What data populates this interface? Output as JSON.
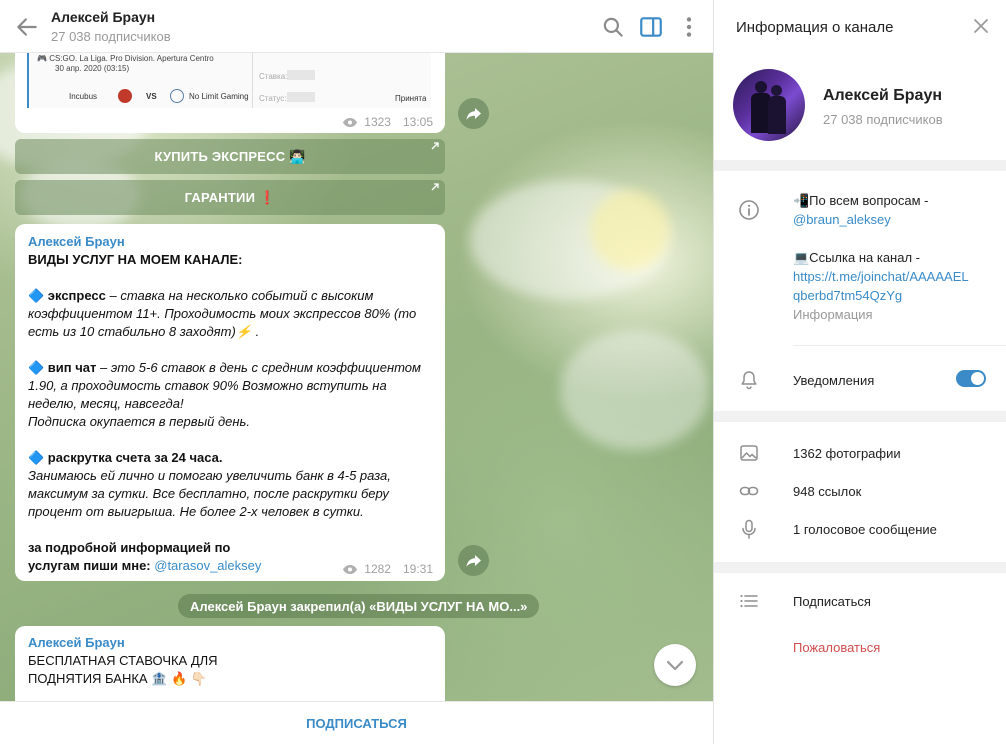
{
  "header": {
    "title": "Алексей Браун",
    "subtitle": "27 038 подписчиков"
  },
  "forwarded_card": {
    "match_line": "CS:GO. La Liga. Pro Division. Apertura Centro",
    "date": "30 апр. 2020 (03:15)",
    "team_left": "Incubus",
    "vs": "VS",
    "team_right": "No Limit Gaming",
    "stake_label": "Ставка:",
    "status_label": "Статус:",
    "status_value": "Принята"
  },
  "msg1_meta": {
    "views": "1323",
    "time": "13:05"
  },
  "keyboard": {
    "btn1": "КУПИТЬ ЭКСПРЕСС 👨🏻‍💻",
    "btn2": "ГАРАНТИИ ❗"
  },
  "msg2": {
    "author": "Алексей Браун",
    "heading": "ВИДЫ УСЛУГ НА МОЕМ КАНАЛЕ:",
    "p1_bold": "🔷 экспресс",
    "p1_text": " – ставка на несколько событий с высоким коэффициентом 11+.  Проходимость моих экспрессов 80% (то есть из 10 стабильно 8 заходят)⚡ .",
    "p2_bold": "🔷 вип чат",
    "p2_text": " – это 5-6 ставок в день с средним коэффициентом 1.90, а проходимость ставок 90% Возможно вступить на неделю, месяц, навсегда!",
    "p2_text2": "Подписка окупается в первый день.",
    "p3_bold": "🔷 раскрутка счета за 24 часа.",
    "p3_text": "Занимаюсь ей лично и помогаю увеличить банк в 4-5 раза, максимум за сутки. Все бесплатно, после раскрутки беру процент от выигрыша. Не более 2-х человек в сутки.",
    "p4_bold1": "за подробной информацией по",
    "p4_bold2": "услугам пиши мне: ",
    "p4_link": "@tarasov_aleksey",
    "views": "1282",
    "time": "19:31"
  },
  "pin_note": "Алексей Браун закрепил(а) «ВИДЫ УСЛУГ НА МО...»",
  "msg3": {
    "author": "Алексей Браун",
    "line1": "БЕСПЛАТНАЯ СТАВОЧКА ДЛЯ",
    "line2": "ПОДНЯТИЯ БАНКА 🏦 🔥 👇🏻"
  },
  "subscribe_label": "ПОДПИСАТЬСЯ",
  "info": {
    "title": "Информация о канале",
    "name": "Алексей Браун",
    "subs": "27 038 подписчиков",
    "desc_line1": "📲По всем вопросам -",
    "desc_link1": "@braun_aleksey",
    "desc_line2": "💻Ссылка на канал -",
    "desc_link2a": "https://t.me/joinchat/AAAAAEL",
    "desc_link2b": "qberbd7tm54QzYg",
    "desc_caption": "Информация",
    "notifications": "Уведомления",
    "photos": "1362 фотографии",
    "links": "948 ссылок",
    "voice": "1 голосовое сообщение",
    "subscribe": "Подписаться",
    "report": "Пожаловаться"
  },
  "colors": {
    "accent": "#3a8bc8",
    "danger": "#d14e4e"
  }
}
